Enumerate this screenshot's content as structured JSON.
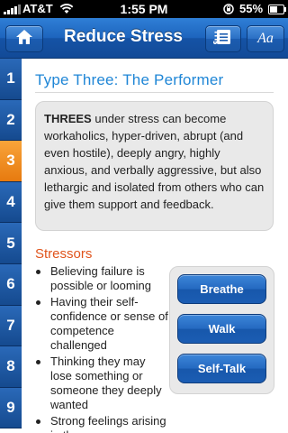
{
  "status_bar": {
    "carrier": "AT&T",
    "time": "1:55 PM",
    "battery_percent": "55%",
    "battery_level": 0.55,
    "icons": [
      "signal-bars-icon",
      "wifi-icon",
      "lock-rotation-icon",
      "battery-icon"
    ]
  },
  "nav": {
    "title": "Reduce Stress",
    "home_icon": "home-icon",
    "notes_icon": "notes-icon",
    "font_label": "Aa"
  },
  "tabs": [
    {
      "label": "1"
    },
    {
      "label": "2"
    },
    {
      "label": "3",
      "active": true
    },
    {
      "label": "4"
    },
    {
      "label": "5"
    },
    {
      "label": "6"
    },
    {
      "label": "7"
    },
    {
      "label": "8"
    },
    {
      "label": "9"
    }
  ],
  "content": {
    "title": "Type Three: The Performer",
    "intro_strong": "THREES",
    "intro_rest": " under stress can become workaholics, hyper-driven, abrupt (and even hostile), deeply angry, highly anxious, and verbally aggressive, but also lethargic and isolated from others who can give them support and feedback.",
    "stressors_heading": "Stressors",
    "stressors": [
      "Believing failure is possible or looming",
      "Having their self-confidence or sense of competence challenged",
      "Thinking they may lose something or someone they deeply wanted",
      "Strong feelings arising in them or"
    ],
    "actions": {
      "breathe": "Breathe",
      "walk": "Walk",
      "self_talk": "Self-Talk"
    }
  },
  "colors": {
    "nav_blue": "#1d64bd",
    "tab_blue": "#154a8f",
    "tab_active_orange": "#f08c22",
    "title_blue": "#1f86d6",
    "heading_orange": "#e0541c"
  }
}
